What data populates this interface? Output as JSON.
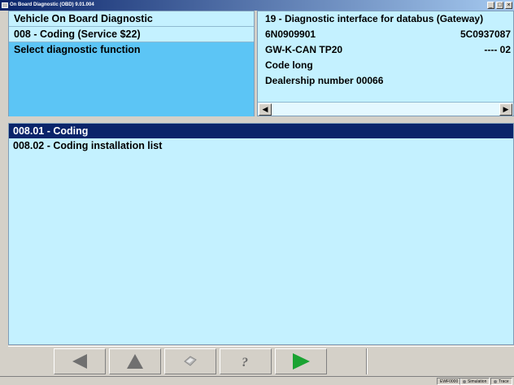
{
  "window": {
    "title": "On Board Diagnostic (OBD) 9.01.004"
  },
  "left_panel": {
    "rows": [
      "Vehicle On Board Diagnostic",
      "008 - Coding (Service $22)",
      "Select diagnostic function"
    ]
  },
  "right_panel": {
    "rows": [
      {
        "label": "19 - Diagnostic interface for databus (Gateway)",
        "value": ""
      },
      {
        "label": "6N0909901",
        "value": "5C0937087"
      },
      {
        "label": "GW-K-CAN TP20",
        "value": "---- 02"
      },
      {
        "label": "Code long",
        "value": ""
      },
      {
        "label": "Dealership number 00066",
        "value": ""
      }
    ]
  },
  "list": {
    "items": [
      "008.01 - Coding",
      "008.02 - Coding installation list"
    ]
  },
  "toolbar": {
    "buttons": [
      "back",
      "up",
      "print",
      "help",
      "go"
    ]
  },
  "status": {
    "items": [
      "EWF0000",
      "Simulation",
      "Trace"
    ]
  },
  "colors": {
    "panel_bg": "#c4f1ff",
    "selected_bg": "#5cc5f5",
    "active_row_bg": "#0a246a",
    "go_green": "#1aa332"
  }
}
